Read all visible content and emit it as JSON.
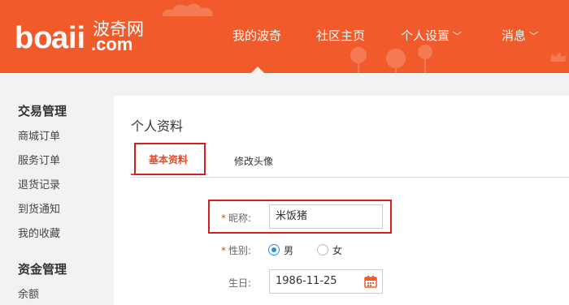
{
  "header": {
    "logo": {
      "wordmark": "boqii.com",
      "chinese": "波奇网"
    },
    "nav": [
      {
        "label": "我的波奇",
        "has_dropdown": false,
        "active": true
      },
      {
        "label": "社区主页",
        "has_dropdown": false
      },
      {
        "label": "个人设置",
        "has_dropdown": true
      },
      {
        "label": "消息",
        "has_dropdown": true
      }
    ],
    "colors": {
      "brand": "#f15a2b"
    }
  },
  "sidebar": {
    "sections": [
      {
        "heading": "交易管理",
        "items": [
          "商城订单",
          "服务订单",
          "退货记录",
          "到货通知",
          "我的收藏"
        ]
      },
      {
        "heading": "资金管理",
        "items": [
          "余额"
        ]
      }
    ]
  },
  "main": {
    "title": "个人资料",
    "tabs": [
      {
        "label": "基本资料",
        "active": true
      },
      {
        "label": "修改头像",
        "active": false
      }
    ],
    "form": {
      "nickname": {
        "label": "昵称:",
        "required": true,
        "value": "米饭猪"
      },
      "gender": {
        "label": "性别:",
        "required": true,
        "options": [
          "男",
          "女"
        ],
        "selected": "男"
      },
      "birthday": {
        "label": "生日:",
        "required": false,
        "value": "1986-11-25",
        "icon": "calendar-icon"
      }
    }
  }
}
